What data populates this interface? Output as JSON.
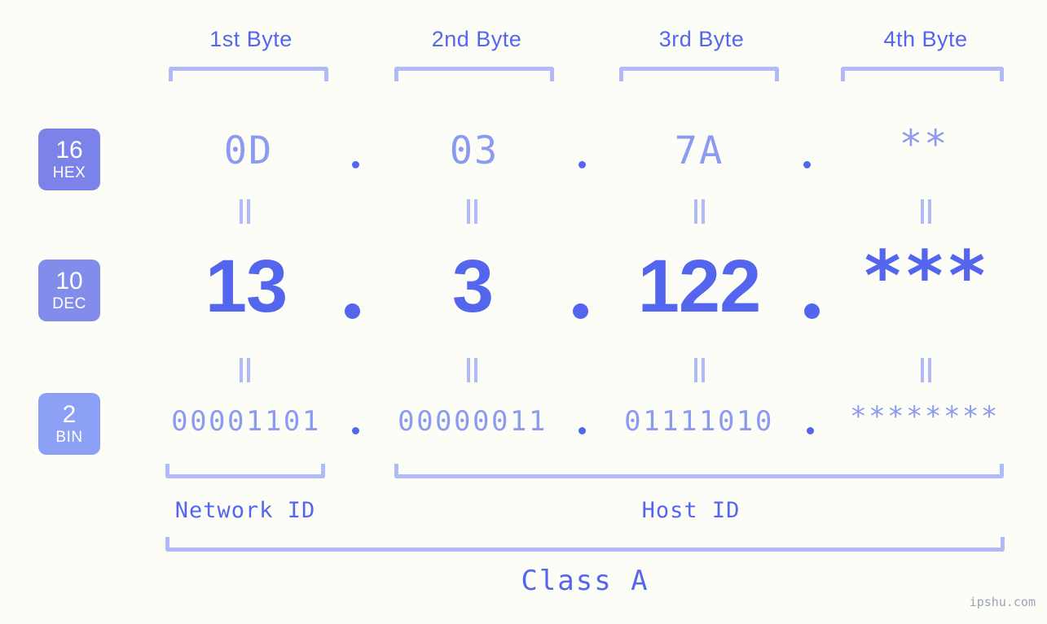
{
  "colors": {
    "background": "#fdfdf8",
    "accent_strong": "#5566ee",
    "accent_light": "#8c9af0",
    "bracket": "#b0baf7",
    "badge_hex": "#7b83e8",
    "badge_dec": "#828ceb",
    "badge_bin": "#8ca0f5",
    "watermark": "#9aa3b8"
  },
  "byte_headers": [
    {
      "label": "1st Byte"
    },
    {
      "label": "2nd Byte"
    },
    {
      "label": "3rd Byte"
    },
    {
      "label": "4th Byte"
    }
  ],
  "rows": [
    {
      "badge_number": "16",
      "badge_system": "HEX",
      "values": [
        "0D",
        "03",
        "7A",
        "**"
      ],
      "separator": "."
    },
    {
      "badge_number": "10",
      "badge_system": "DEC",
      "values": [
        "13",
        "3",
        "122",
        "***"
      ],
      "separator": "."
    },
    {
      "badge_number": "2",
      "badge_system": "BIN",
      "values": [
        "00001101",
        "00000011",
        "01111010",
        "********"
      ],
      "separator": "."
    }
  ],
  "connectors": {
    "symbol": "||",
    "count_per_row": 4
  },
  "sections": [
    {
      "label": "Network ID"
    },
    {
      "label": "Host ID"
    }
  ],
  "class_label": "Class A",
  "watermark": "ipshu.com"
}
